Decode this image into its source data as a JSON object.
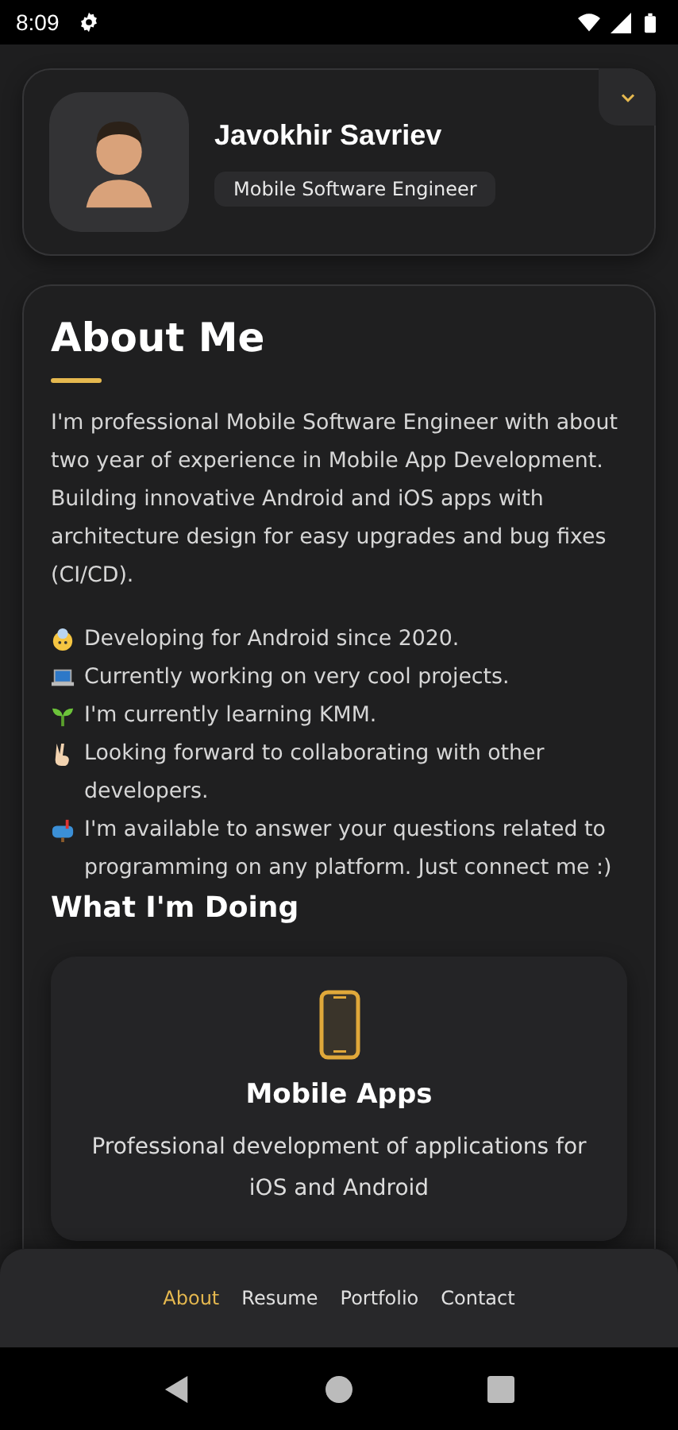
{
  "status_bar": {
    "time": "8:09"
  },
  "profile": {
    "name": "Javokhir Savriev",
    "title": "Mobile Software Engineer"
  },
  "about": {
    "heading": "About Me",
    "intro": "I'm professional Mobile Software Engineer with about two year of experience in Mobile App Development. Building innovative Android and iOS apps with architecture design for easy upgrades and bug fixes (CI/CD).",
    "facts": [
      "Developing for Android since 2020.",
      "Currently working on very cool projects.",
      "I'm currently learning KMM.",
      "Looking forward to collaborating with other developers.",
      "I'm available to answer your questions related to programming on any platform. Just connect me :)"
    ],
    "doing_heading": "What I'm Doing",
    "services": [
      {
        "title": "Mobile Apps",
        "description": "Professional development of applications for iOS and Android"
      }
    ]
  },
  "nav": [
    {
      "label": "About",
      "selected": true
    },
    {
      "label": "Resume",
      "selected": false
    },
    {
      "label": "Portfolio",
      "selected": false
    },
    {
      "label": "Contact",
      "selected": false
    }
  ]
}
